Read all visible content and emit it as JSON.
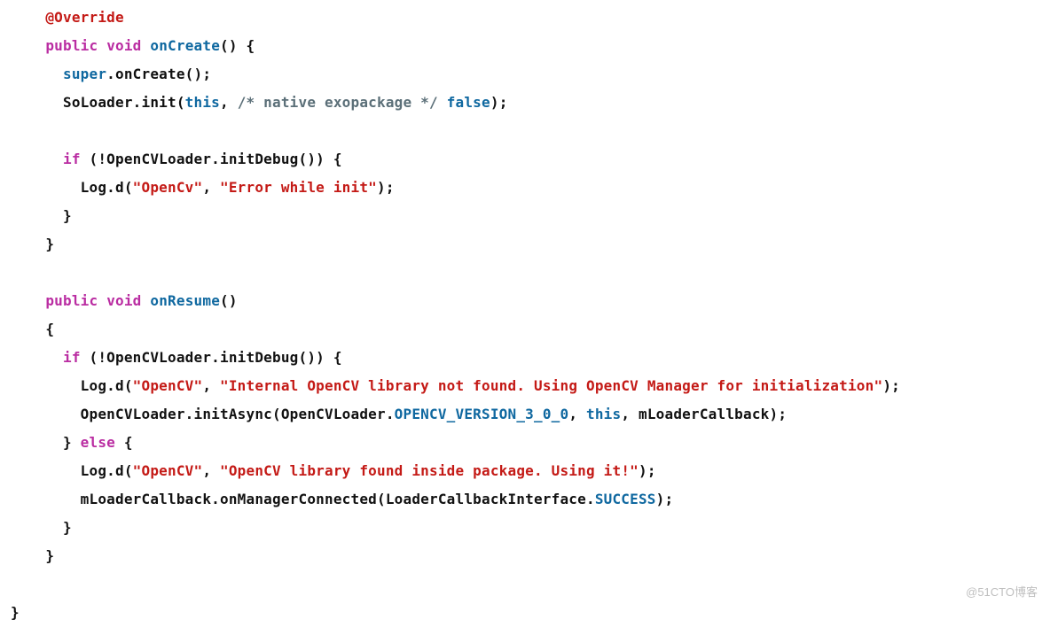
{
  "code": {
    "lines": [
      {
        "indent": 2,
        "segs": [
          {
            "cls": "tok-ann",
            "t": "@Override"
          }
        ]
      },
      {
        "indent": 2,
        "segs": [
          {
            "cls": "tok-kw",
            "t": "public"
          },
          {
            "t": " "
          },
          {
            "cls": "tok-kw",
            "t": "void"
          },
          {
            "t": " "
          },
          {
            "cls": "tok-fn",
            "t": "onCreate"
          },
          {
            "t": "() {"
          }
        ]
      },
      {
        "indent": 3,
        "segs": [
          {
            "cls": "tok-kw2",
            "t": "super"
          },
          {
            "t": ".onCreate();"
          }
        ]
      },
      {
        "indent": 3,
        "segs": [
          {
            "t": "SoLoader.init("
          },
          {
            "cls": "tok-kw2",
            "t": "this"
          },
          {
            "t": ", "
          },
          {
            "cls": "tok-cmt",
            "t": "/* native exopackage */"
          },
          {
            "t": " "
          },
          {
            "cls": "tok-kw2",
            "t": "false"
          },
          {
            "t": ");"
          }
        ]
      },
      {
        "indent": 0,
        "segs": [
          {
            "t": ""
          }
        ]
      },
      {
        "indent": 3,
        "segs": [
          {
            "cls": "tok-kw",
            "t": "if"
          },
          {
            "t": " (!OpenCVLoader.initDebug()) {"
          }
        ]
      },
      {
        "indent": 4,
        "segs": [
          {
            "t": "Log.d("
          },
          {
            "cls": "tok-str",
            "t": "\"OpenCv\""
          },
          {
            "t": ", "
          },
          {
            "cls": "tok-str",
            "t": "\"Error while init\""
          },
          {
            "t": ");"
          }
        ]
      },
      {
        "indent": 3,
        "segs": [
          {
            "t": "}"
          }
        ]
      },
      {
        "indent": 2,
        "segs": [
          {
            "t": "}"
          }
        ]
      },
      {
        "indent": 0,
        "segs": [
          {
            "t": ""
          }
        ]
      },
      {
        "indent": 2,
        "segs": [
          {
            "cls": "tok-kw",
            "t": "public"
          },
          {
            "t": " "
          },
          {
            "cls": "tok-kw",
            "t": "void"
          },
          {
            "t": " "
          },
          {
            "cls": "tok-fn",
            "t": "onResume"
          },
          {
            "t": "()"
          }
        ]
      },
      {
        "indent": 2,
        "segs": [
          {
            "t": "{"
          }
        ]
      },
      {
        "indent": 3,
        "segs": [
          {
            "cls": "tok-kw",
            "t": "if"
          },
          {
            "t": " (!OpenCVLoader.initDebug()) {"
          }
        ]
      },
      {
        "indent": 4,
        "segs": [
          {
            "t": "Log.d("
          },
          {
            "cls": "tok-str",
            "t": "\"OpenCV\""
          },
          {
            "t": ", "
          },
          {
            "cls": "tok-str",
            "t": "\"Internal OpenCV library not found. Using OpenCV Manager for initialization\""
          },
          {
            "t": ");"
          }
        ]
      },
      {
        "indent": 4,
        "segs": [
          {
            "t": "OpenCVLoader.initAsync(OpenCVLoader."
          },
          {
            "cls": "tok-const",
            "t": "OPENCV_VERSION_3_0_0"
          },
          {
            "t": ", "
          },
          {
            "cls": "tok-kw2",
            "t": "this"
          },
          {
            "t": ", mLoaderCallback);"
          }
        ]
      },
      {
        "indent": 3,
        "segs": [
          {
            "t": "} "
          },
          {
            "cls": "tok-kw",
            "t": "else"
          },
          {
            "t": " {"
          }
        ]
      },
      {
        "indent": 4,
        "segs": [
          {
            "t": "Log.d("
          },
          {
            "cls": "tok-str",
            "t": "\"OpenCV\""
          },
          {
            "t": ", "
          },
          {
            "cls": "tok-str",
            "t": "\"OpenCV library found inside package. Using it!\""
          },
          {
            "t": ");"
          }
        ]
      },
      {
        "indent": 4,
        "segs": [
          {
            "t": "mLoaderCallback.onManagerConnected(LoaderCallbackInterface."
          },
          {
            "cls": "tok-const",
            "t": "SUCCESS"
          },
          {
            "t": ");"
          }
        ]
      },
      {
        "indent": 3,
        "segs": [
          {
            "t": "}"
          }
        ]
      },
      {
        "indent": 2,
        "segs": [
          {
            "t": "}"
          }
        ]
      },
      {
        "indent": 0,
        "segs": [
          {
            "t": ""
          }
        ]
      },
      {
        "indent": 0,
        "segs": [
          {
            "t": "}"
          }
        ]
      }
    ]
  },
  "watermark": "@51CTO博客"
}
